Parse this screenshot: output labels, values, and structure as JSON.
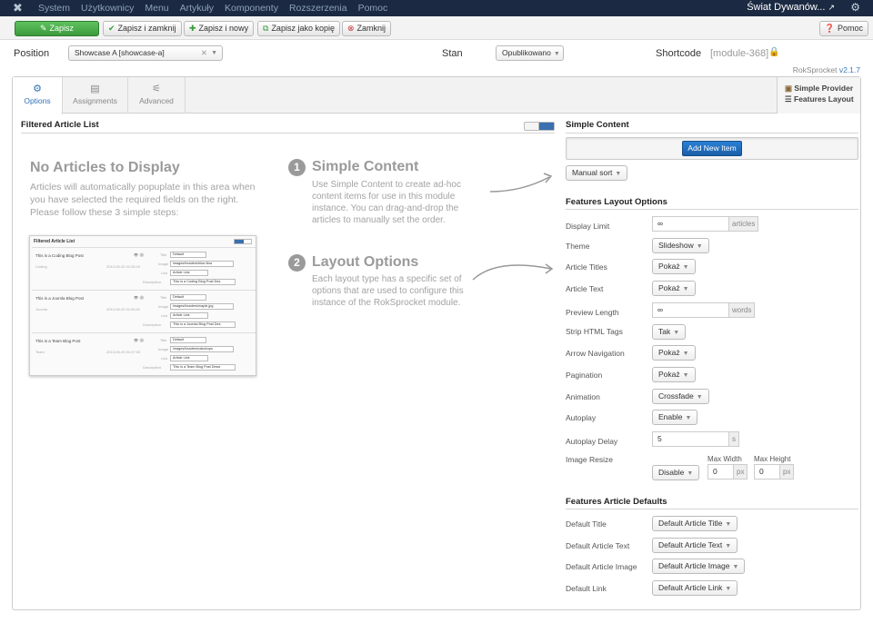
{
  "topbar": {
    "menu": [
      "System",
      "Użytkownicy",
      "Menu",
      "Artykuły",
      "Komponenty",
      "Rozszerzenia",
      "Pomoc"
    ],
    "site_name": "Świat Dywanów...",
    "site_icon": "external-link-icon"
  },
  "toolbar": {
    "save": "Zapisz",
    "save_close": "Zapisz i zamknij",
    "save_new": "Zapisz i nowy",
    "save_copy": "Zapisz jako kopię",
    "close": "Zamknij",
    "help": "Pomoc",
    "green": "#47a447"
  },
  "form": {
    "position_label": "Position",
    "position_value": "Showcase A [showcase-a]",
    "stan_label": "Stan",
    "stan_value": "Opublikowano",
    "shortcode_label": "Shortcode",
    "shortcode_value": "[module-368]"
  },
  "version": {
    "name": "RokSprocket",
    "number": "v2.1.7"
  },
  "tabs": [
    "Options",
    "Assignments",
    "Advanced"
  ],
  "provider": {
    "line1": "Simple Provider",
    "line2": "Features Layout"
  },
  "left": {
    "title": "Filtered Article List",
    "empty_title": "No Articles to Display",
    "empty_text": [
      "Articles will automatically popuplate in this area when",
      "you have selected the required fields on the right.",
      "Please follow these 3 simple steps:"
    ],
    "step1_num": "1",
    "step1_title": "Simple Content",
    "step1_text": [
      "Use Simple Content to create ad-hoc",
      "content items for use in this module",
      "instance. You can drag-and-drop the",
      "articles to manually set the order."
    ],
    "step2_num": "2",
    "step2_title": "Layout Options",
    "step2_text": [
      "Each layout type has a specific set of",
      "options that are used to configure this",
      "instance of the RokSprocket module."
    ]
  },
  "thumb": {
    "title": "Filtered Article List",
    "rows": [
      {
        "title": "This is a Coding Blog Post",
        "cat": "Coding",
        "date": "2013-05-20 01:08:19",
        "image": "images/headers/blue-flow",
        "desc": "This is a Coding Blog Post Des"
      },
      {
        "title": "This is a Joomla Blog Post",
        "cat": "Joomla",
        "date": "2013-05-20 01:06:01",
        "image": "images/headers/maple.jpg",
        "desc": "This is a Joomla Blog Post Des"
      },
      {
        "title": "This is a Team Blog Post",
        "cat": "Team",
        "date": "2013-05-20 01:07:03",
        "image": "images/headers/raindrops",
        "desc": "This is a Team Blog Post Descr"
      }
    ],
    "labels": {
      "title": "Title",
      "image": "Image",
      "link": "Link",
      "desc": "Description",
      "default": "Default",
      "article_link": "Article Link"
    }
  },
  "right": {
    "simple_content_title": "Simple Content",
    "add_new_item": "Add New Item",
    "manual_sort": "Manual sort",
    "features_layout_title": "Features Layout Options",
    "display_limit_label": "Display Limit",
    "display_limit_value": "∞",
    "display_limit_unit": "articles",
    "theme_label": "Theme",
    "theme_value": "Slideshow",
    "article_titles_label": "Article Titles",
    "article_titles_value": "Pokaż",
    "article_text_label": "Article Text",
    "article_text_value": "Pokaż",
    "preview_length_label": "Preview Length",
    "preview_length_value": "∞",
    "preview_length_unit": "words",
    "strip_html_label": "Strip HTML Tags",
    "strip_html_value": "Tak",
    "arrow_nav_label": "Arrow Navigation",
    "arrow_nav_value": "Pokaż",
    "pagination_label": "Pagination",
    "pagination_value": "Pokaż",
    "animation_label": "Animation",
    "animation_value": "Crossfade",
    "autoplay_label": "Autoplay",
    "autoplay_value": "Enable",
    "autoplay_delay_label": "Autoplay Delay",
    "autoplay_delay_value": "5",
    "autoplay_delay_unit": "s",
    "image_resize_label": "Image Resize",
    "image_resize_value": "Disable",
    "max_width_label": "Max Width",
    "max_width_value": "0",
    "max_height_label": "Max Height",
    "max_height_value": "0",
    "px": "px",
    "defaults_title": "Features Article Defaults",
    "default_title_label": "Default Title",
    "default_title_value": "Default Article Title",
    "default_text_label": "Default Article Text",
    "default_text_value": "Default Article Text",
    "default_image_label": "Default Article Image",
    "default_image_value": "Default Article Image",
    "default_link_label": "Default Link",
    "default_link_value": "Default Article Link"
  }
}
